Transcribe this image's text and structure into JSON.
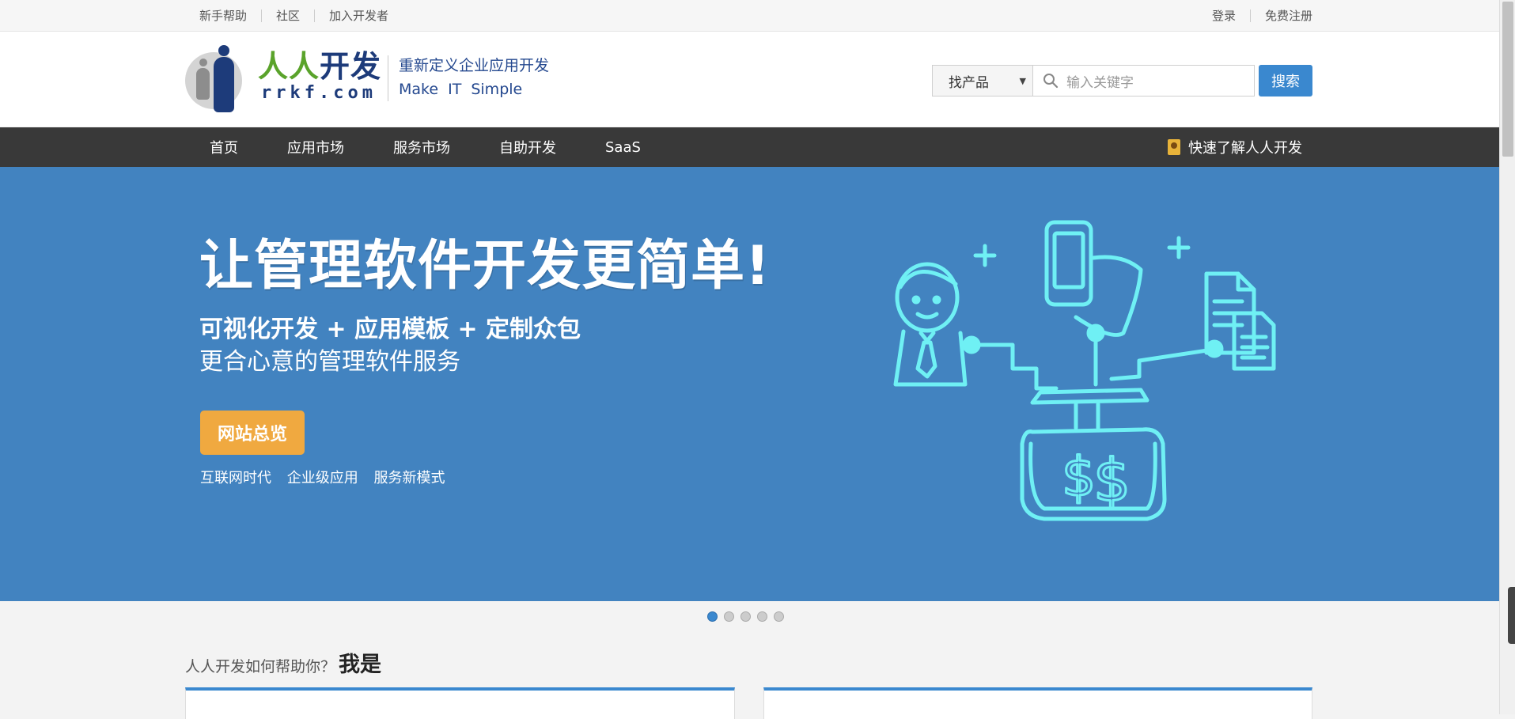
{
  "topbar": {
    "links": [
      "新手帮助",
      "社区",
      "加入开发者"
    ],
    "user_links": [
      "登录",
      "免费注册"
    ]
  },
  "header": {
    "logo_cn_1": "人人",
    "logo_cn_2": "开发",
    "logo_en": "rrkf.com",
    "slogan_cn": "重新定义企业应用开发",
    "slogan_en": "Make IT Simple",
    "search_select": "找产品",
    "search_placeholder": "输入关键字",
    "search_button": "搜索"
  },
  "nav": {
    "items": [
      "首页",
      "应用市场",
      "服务市场",
      "自助开发",
      "SaaS"
    ],
    "quick": "快速了解人人开发"
  },
  "banner": {
    "headline": "让管理软件开发更简单!",
    "sub1": "可视化开发 + 应用模板 + 定制众包",
    "sub2": "更合心意的管理软件服务",
    "cta": "网站总览",
    "tags": [
      "互联网时代",
      "企业级应用",
      "服务新模式"
    ]
  },
  "carousel": {
    "count": 5,
    "active": 1
  },
  "help": {
    "question": "人人开发如何帮助你？",
    "i_am": "我是"
  },
  "colors": {
    "banner": "#4283c0",
    "nav": "#393939",
    "accent": "#3a88cf",
    "cta": "#f0a940",
    "illustration": "#6ff0f4"
  }
}
